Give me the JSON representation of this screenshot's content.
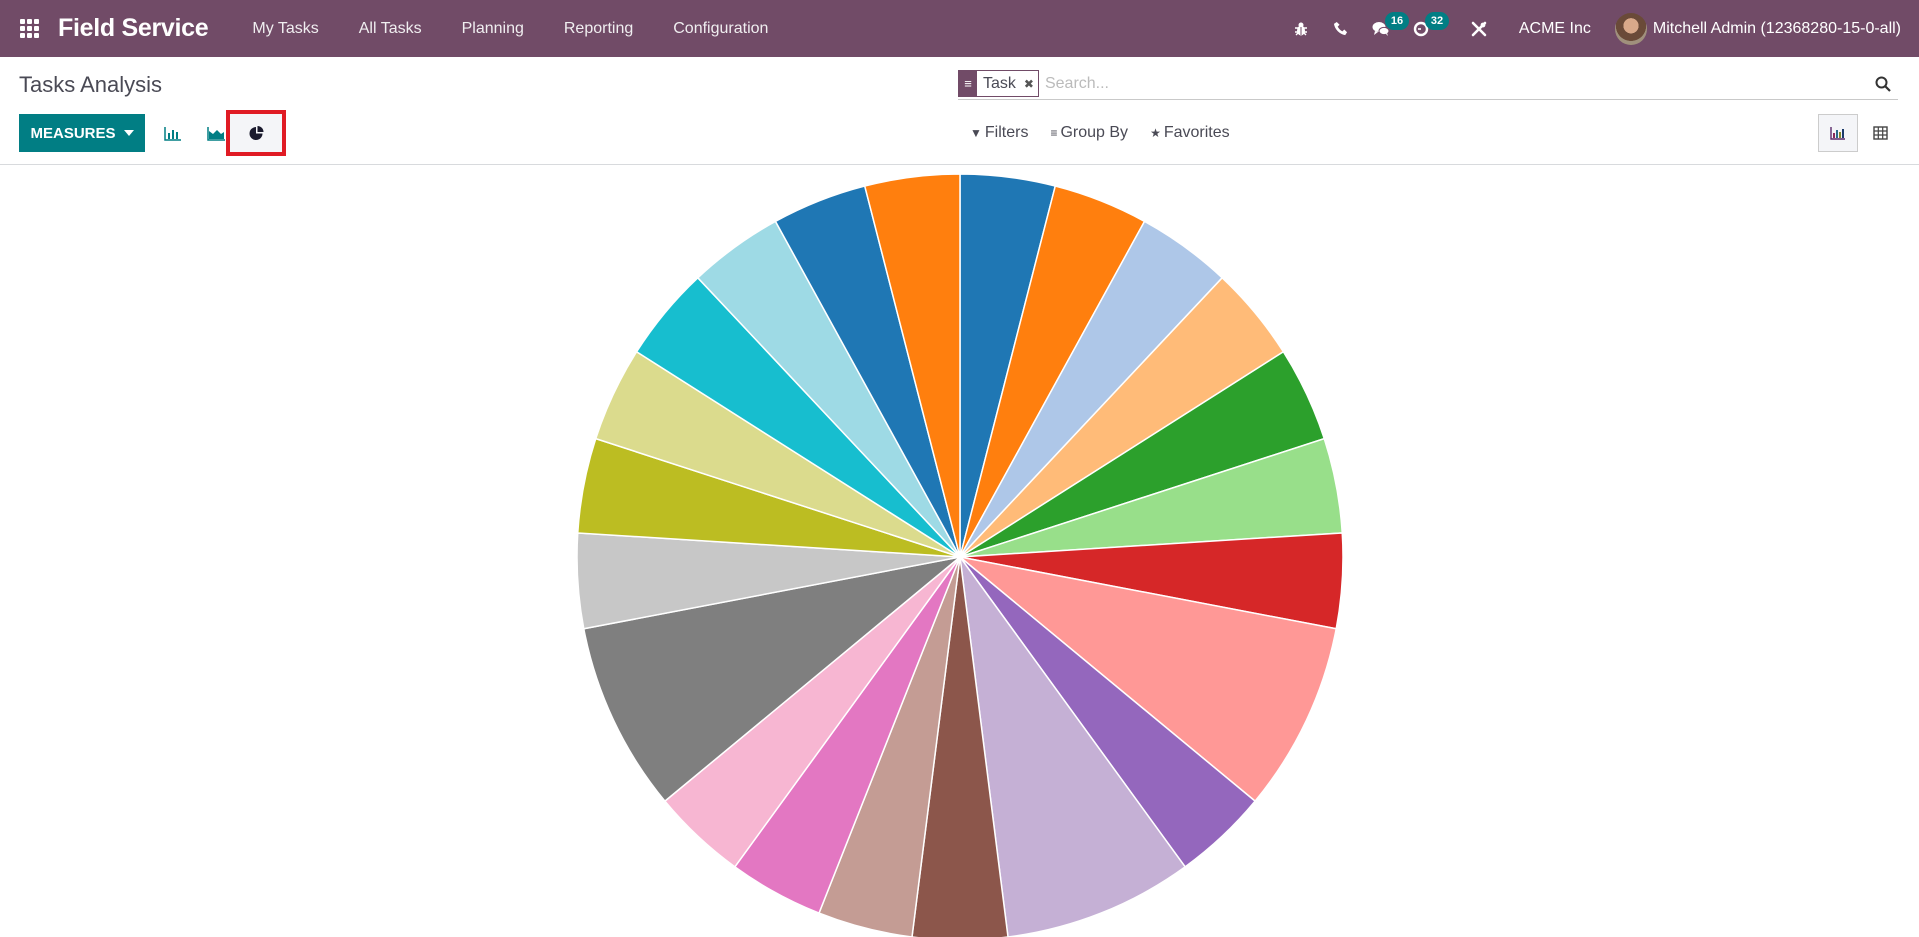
{
  "navbar": {
    "app_name": "Field Service",
    "menu": [
      "My Tasks",
      "All Tasks",
      "Planning",
      "Reporting",
      "Configuration"
    ],
    "icons": [
      "bug-icon",
      "phone-icon",
      "chat-icon",
      "activity-clock-icon",
      "tools-icon"
    ],
    "messages_count": "16",
    "activities_count": "32",
    "company": "ACME Inc",
    "user": "Mitchell Admin (12368280-15-0-all)"
  },
  "control_panel": {
    "title": "Tasks Analysis",
    "measures_label": "MEASURES",
    "chart_types": [
      "bar",
      "line",
      "pie"
    ],
    "active_chart_type": "pie",
    "search": {
      "facet_value": "Task",
      "placeholder": "Search..."
    },
    "filters_label": "Filters",
    "groupby_label": "Group By",
    "favorites_label": "Favorites",
    "views": [
      "graph",
      "pivot"
    ],
    "active_view": "graph"
  },
  "chart_data": {
    "type": "pie",
    "title": "",
    "legend": "none",
    "values": [
      1,
      1,
      1,
      1,
      1,
      1,
      1,
      2,
      1,
      2,
      1,
      1,
      1,
      1,
      2,
      1,
      1,
      1,
      1,
      1,
      1,
      1
    ],
    "colors": [
      "#1f77b4",
      "#ff7f0e",
      "#aec7e8",
      "#ffbb78",
      "#2ca02c",
      "#98df8a",
      "#d62728",
      "#ff9896",
      "#9467bd",
      "#c5b0d5",
      "#8c564b",
      "#c49c94",
      "#e377c2",
      "#f7b6d2",
      "#7f7f7f",
      "#c7c7c7",
      "#bcbd22",
      "#dbdb8d",
      "#17becf",
      "#9edae5",
      "#1f77b4",
      "#ff7f0e"
    ],
    "start": "12 o'clock",
    "direction": "clockwise"
  }
}
